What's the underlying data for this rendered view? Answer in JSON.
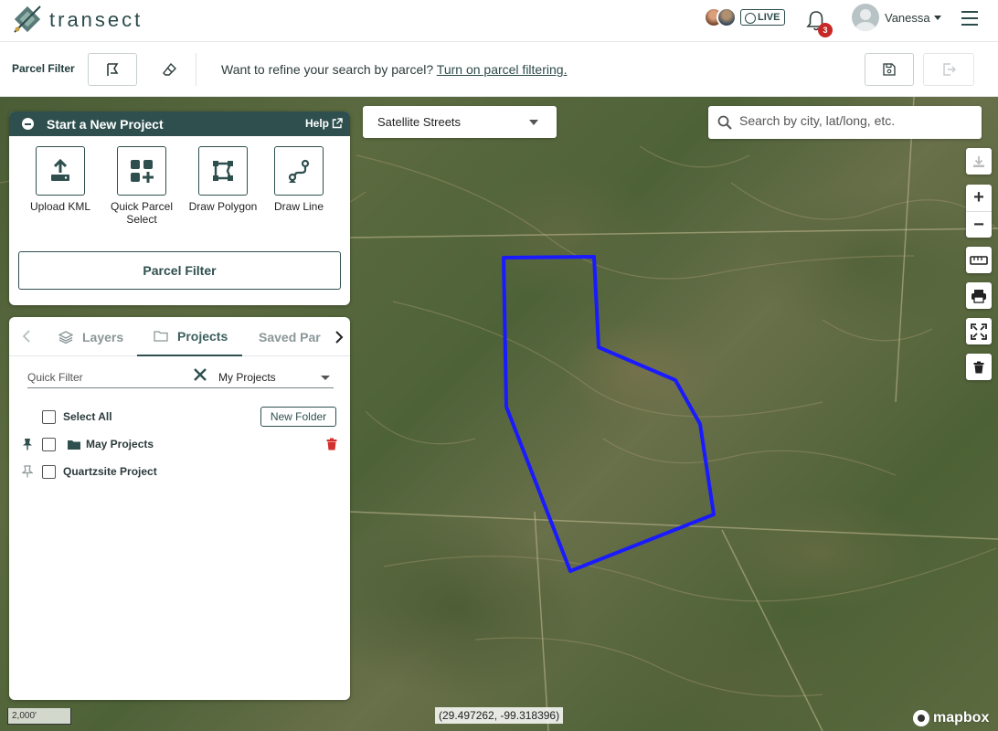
{
  "header": {
    "logo_text": "transect",
    "live_label": "LIVE",
    "notification_count": "3",
    "user_name": "Vanessa"
  },
  "toolbar": {
    "parcel_filter_label": "Parcel Filter",
    "message": "Want to refine your search by parcel?",
    "message_link": "Turn on parcel filtering."
  },
  "map": {
    "style_select": "Satellite Streets",
    "search_placeholder": "Search by city, lat/long, etc.",
    "zoom_in": "+",
    "zoom_out": "−",
    "scale_label": "2,000'",
    "coordinates": "(29.497262, -99.318396)",
    "attribution": "mapbox"
  },
  "new_project": {
    "title": "Start a New Project",
    "help_label": "Help",
    "tools": [
      {
        "label": "Upload KML",
        "icon": "upload-icon"
      },
      {
        "label": "Quick Parcel Select",
        "icon": "grid-plus-icon"
      },
      {
        "label": "Draw Polygon",
        "icon": "polygon-icon"
      },
      {
        "label": "Draw Line",
        "icon": "line-icon"
      }
    ],
    "parcel_filter_button": "Parcel Filter"
  },
  "panel": {
    "tabs": [
      {
        "label": "Layers",
        "icon": "layers-icon"
      },
      {
        "label": "Projects",
        "icon": "folder-icon"
      },
      {
        "label": "Saved Par",
        "icon": ""
      }
    ],
    "quick_filter_placeholder": "Quick Filter",
    "projects_filter": "My Projects",
    "select_all": "Select All",
    "new_folder": "New Folder",
    "items": [
      {
        "label": "May Projects",
        "type": "folder",
        "pinned": true
      },
      {
        "label": "Quartzsite Project",
        "type": "project",
        "pinned": false
      }
    ]
  },
  "colors": {
    "primary": "#2f4f4f",
    "polygon": "#1a1aff",
    "badge": "#c62828",
    "delete": "#d32f2f"
  }
}
